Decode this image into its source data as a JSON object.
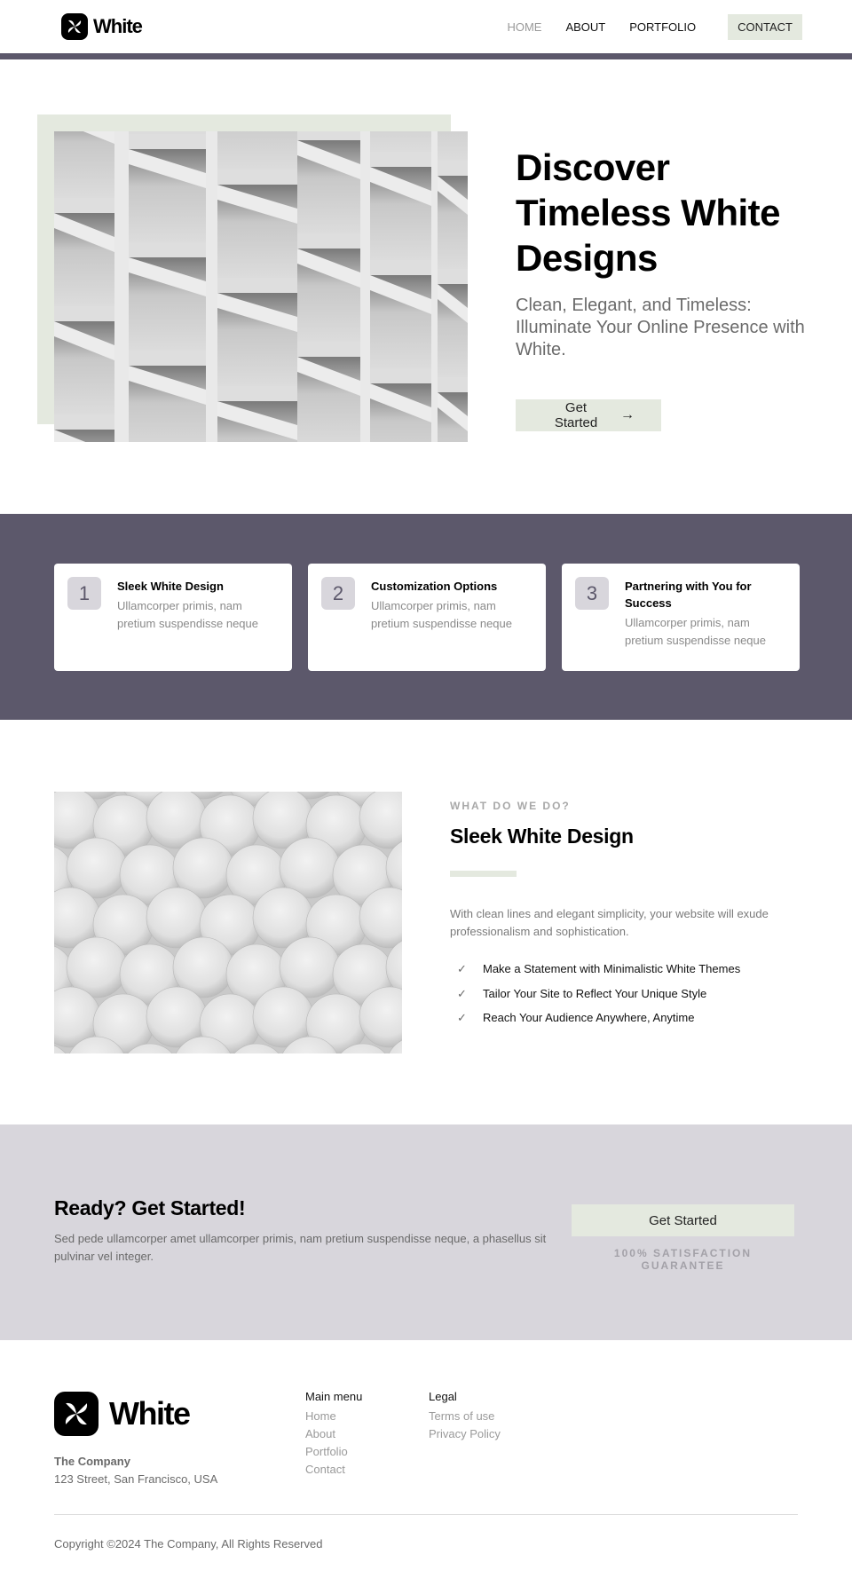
{
  "brand": {
    "name": "White",
    "colors": {
      "accent": "#e4e9df",
      "band": "#5c586b",
      "cta_bg": "#d8d6dc",
      "number_tile": "#d8d6dc"
    }
  },
  "nav": {
    "items": [
      {
        "label": "HOME",
        "active": true
      },
      {
        "label": "ABOUT",
        "active": false
      },
      {
        "label": "PORTFOLIO",
        "active": false
      },
      {
        "label": "CONTACT",
        "active": false
      }
    ]
  },
  "hero": {
    "title": "Discover Timeless White Designs",
    "subtitle": "Clean, Elegant, and Timeless: Illuminate Your Online Presence with White.",
    "button_label": "Get Started",
    "button_icon": "arrow-right-icon",
    "image_alt": "white building facade"
  },
  "features": {
    "cards": [
      {
        "number": "1",
        "title": "Sleek White Design",
        "description": "Ullamcorper primis, nam pretium suspendisse neque"
      },
      {
        "number": "2",
        "title": "Customization Options",
        "description": "Ullamcorper primis, nam pretium suspendisse neque"
      },
      {
        "number": "3",
        "title": "Partnering with You for Success",
        "description": "Ullamcorper primis, nam pretium suspendisse neque"
      }
    ]
  },
  "what_we_do": {
    "eyebrow": "WHAT DO WE DO?",
    "title": "Sleek White Design",
    "description": "With clean lines and elegant simplicity, your website will exude professionalism and sophistication.",
    "checklist": [
      "Make a Statement with Minimalistic White Themes",
      "Tailor Your Site to Reflect Your Unique Style",
      "Reach Your Audience Anywhere, Anytime"
    ],
    "image_alt": "white spheres"
  },
  "cta": {
    "title": "Ready? Get Started!",
    "description": "Sed pede ullamcorper amet ullamcorper primis, nam pretium suspendisse neque, a phasellus sit pulvinar vel integer.",
    "button_label": "Get Started",
    "guarantee": "100% SATISFACTION GUARANTEE"
  },
  "footer": {
    "company_name": "The Company",
    "address": "123 Street, San Francisco, USA",
    "main_menu": {
      "title": "Main menu",
      "links": [
        "Home",
        "About",
        "Portfolio",
        "Contact"
      ]
    },
    "legal": {
      "title": "Legal",
      "links": [
        "Terms of use",
        "Privacy Policy"
      ]
    },
    "copyright": "Copyright ©2024 The Company, All Rights Reserved"
  }
}
